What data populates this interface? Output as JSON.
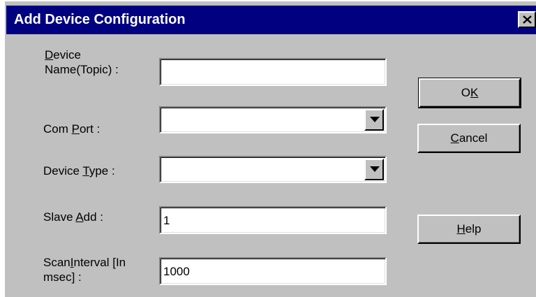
{
  "dialog": {
    "title": "Add Device Configuration",
    "close_label": "Close"
  },
  "fields": {
    "device_name": {
      "label_line1_pre": "",
      "label_line1_mnemonic": "D",
      "label_line1_post": "evice",
      "label_line2": "Name(Topic) :",
      "value": ""
    },
    "com_port": {
      "label_pre": "Com ",
      "label_mnemonic": "P",
      "label_post": "ort :",
      "value": ""
    },
    "device_type": {
      "label_pre": "Device ",
      "label_mnemonic": "T",
      "label_post": "ype :",
      "value": ""
    },
    "slave_add": {
      "label_pre": "Slave ",
      "label_mnemonic": "A",
      "label_post": "dd :",
      "value": "1"
    },
    "scan_interval": {
      "label_line1_pre": "Scan",
      "label_line1_mnemonic": "I",
      "label_line1_post": "nterval [In",
      "label_line2": "msec]    :",
      "value": "1000"
    }
  },
  "buttons": {
    "ok": {
      "pre": "O",
      "mnemonic": "K",
      "post": ""
    },
    "cancel": {
      "pre": "",
      "mnemonic": "C",
      "post": "ancel"
    },
    "help": {
      "pre": "",
      "mnemonic": "H",
      "post": "elp"
    }
  },
  "colors": {
    "titlebar": "#000080",
    "dialog_face": "#c0c0c0",
    "field_bg": "#ffffff"
  },
  "icons": {
    "close": "close-x-icon",
    "dropdown": "dropdown-arrow-icon"
  }
}
